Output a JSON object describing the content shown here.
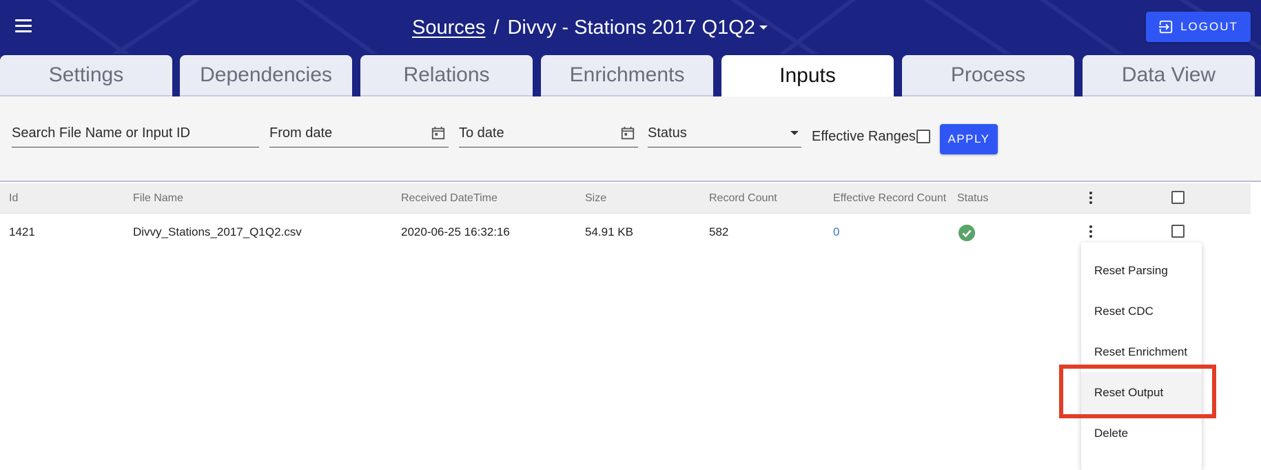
{
  "header": {
    "menu_icon": "hamburger-menu-icon",
    "breadcrumb_link": "Sources",
    "breadcrumb_separator": "/",
    "title": "Divvy - Stations 2017 Q1Q2",
    "title_dropdown_icon": "caret-down-icon",
    "logout_label": "LOGOUT",
    "logout_icon": "logout-icon",
    "background_color": "#1b2483",
    "accent_color": "#2f56f4"
  },
  "tabs": [
    {
      "label": "Settings",
      "active": false
    },
    {
      "label": "Dependencies",
      "active": false
    },
    {
      "label": "Relations",
      "active": false
    },
    {
      "label": "Enrichments",
      "active": false
    },
    {
      "label": "Inputs",
      "active": true
    },
    {
      "label": "Process",
      "active": false
    },
    {
      "label": "Data View",
      "active": false
    }
  ],
  "filters": {
    "search_placeholder": "Search File Name or Input ID",
    "from_date_placeholder": "From date",
    "to_date_placeholder": "To date",
    "calendar_icon": "calendar-icon",
    "status_placeholder": "Status",
    "effective_ranges_label": "Effective Ranges",
    "effective_ranges_checked": false,
    "apply_label": "APPLY"
  },
  "table": {
    "columns": [
      "Id",
      "File Name",
      "Received DateTime",
      "Size",
      "Record Count",
      "Effective Record Count",
      "Status"
    ],
    "rows": [
      {
        "id": "1421",
        "file_name": "Divvy_Stations_2017_Q1Q2.csv",
        "received": "2020-06-25 16:32:16",
        "size": "54.91 KB",
        "record_count": "582",
        "effective_record_count": "0",
        "status_icon": "check-circle-icon",
        "status_color": "#5aa469"
      }
    ]
  },
  "context_menu": {
    "items": [
      "Reset Parsing",
      "Reset CDC",
      "Reset Enrichment",
      "Reset Output",
      "Delete"
    ],
    "highlighted_item": "Reset Output",
    "highlight_color": "#e23d26"
  }
}
